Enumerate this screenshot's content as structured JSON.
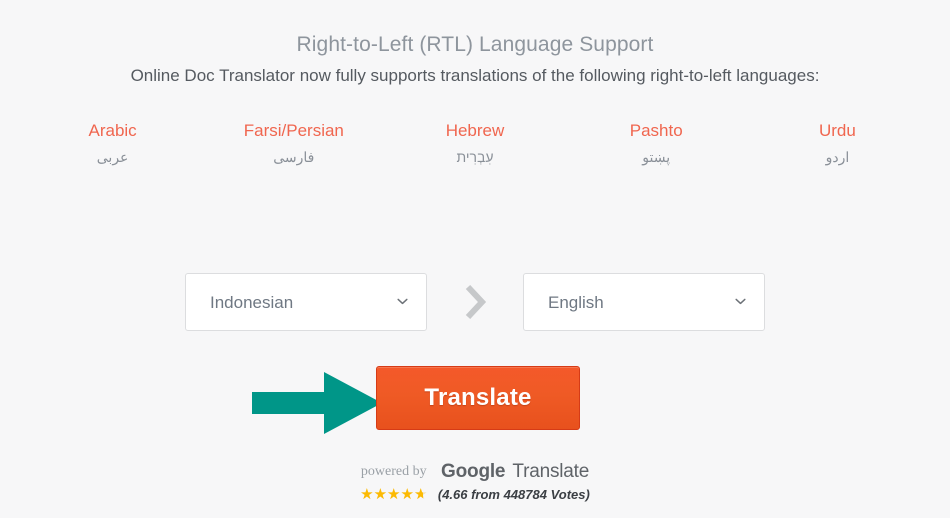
{
  "heading": {
    "title": "Right-to-Left (RTL) Language Support",
    "subtitle": "Online Doc Translator now fully supports translations of the following right-to-left languages:"
  },
  "languages": [
    {
      "name": "Arabic",
      "native": "عربى"
    },
    {
      "name": "Farsi/Persian",
      "native": "فارسى"
    },
    {
      "name": "Hebrew",
      "native": "עִבְרִית"
    },
    {
      "name": "Pashto",
      "native": "پښتو"
    },
    {
      "name": "Urdu",
      "native": "اردو"
    }
  ],
  "translator": {
    "source_language": "Indonesian",
    "target_language": "English",
    "source_icon": "chevron-down-icon",
    "target_icon": "chevron-down-icon",
    "separator_icon": "chevron-right-icon",
    "pointer_icon": "right-arrow-icon",
    "translate_label": "Translate"
  },
  "footer": {
    "powered_by_label": "powered by",
    "brand_primary": "Google",
    "brand_secondary": "Translate",
    "stars_glyphs": "★★★★★",
    "rating_value": "4.66",
    "rating_fill_percent": "93",
    "rating_text": "(4.66 from 448784 Votes)"
  },
  "colors": {
    "page_background": "#f7f7f8",
    "heading_grey": "#8e959d",
    "subheading_grey": "#555a60",
    "language_accent": "#f0664f",
    "native_grey": "#8a9098",
    "button_orange": "#ef5a25",
    "button_border": "#d63b16",
    "pointer_teal": "#009688",
    "star_gold": "#fcba03",
    "select_border": "#dcdddf"
  }
}
